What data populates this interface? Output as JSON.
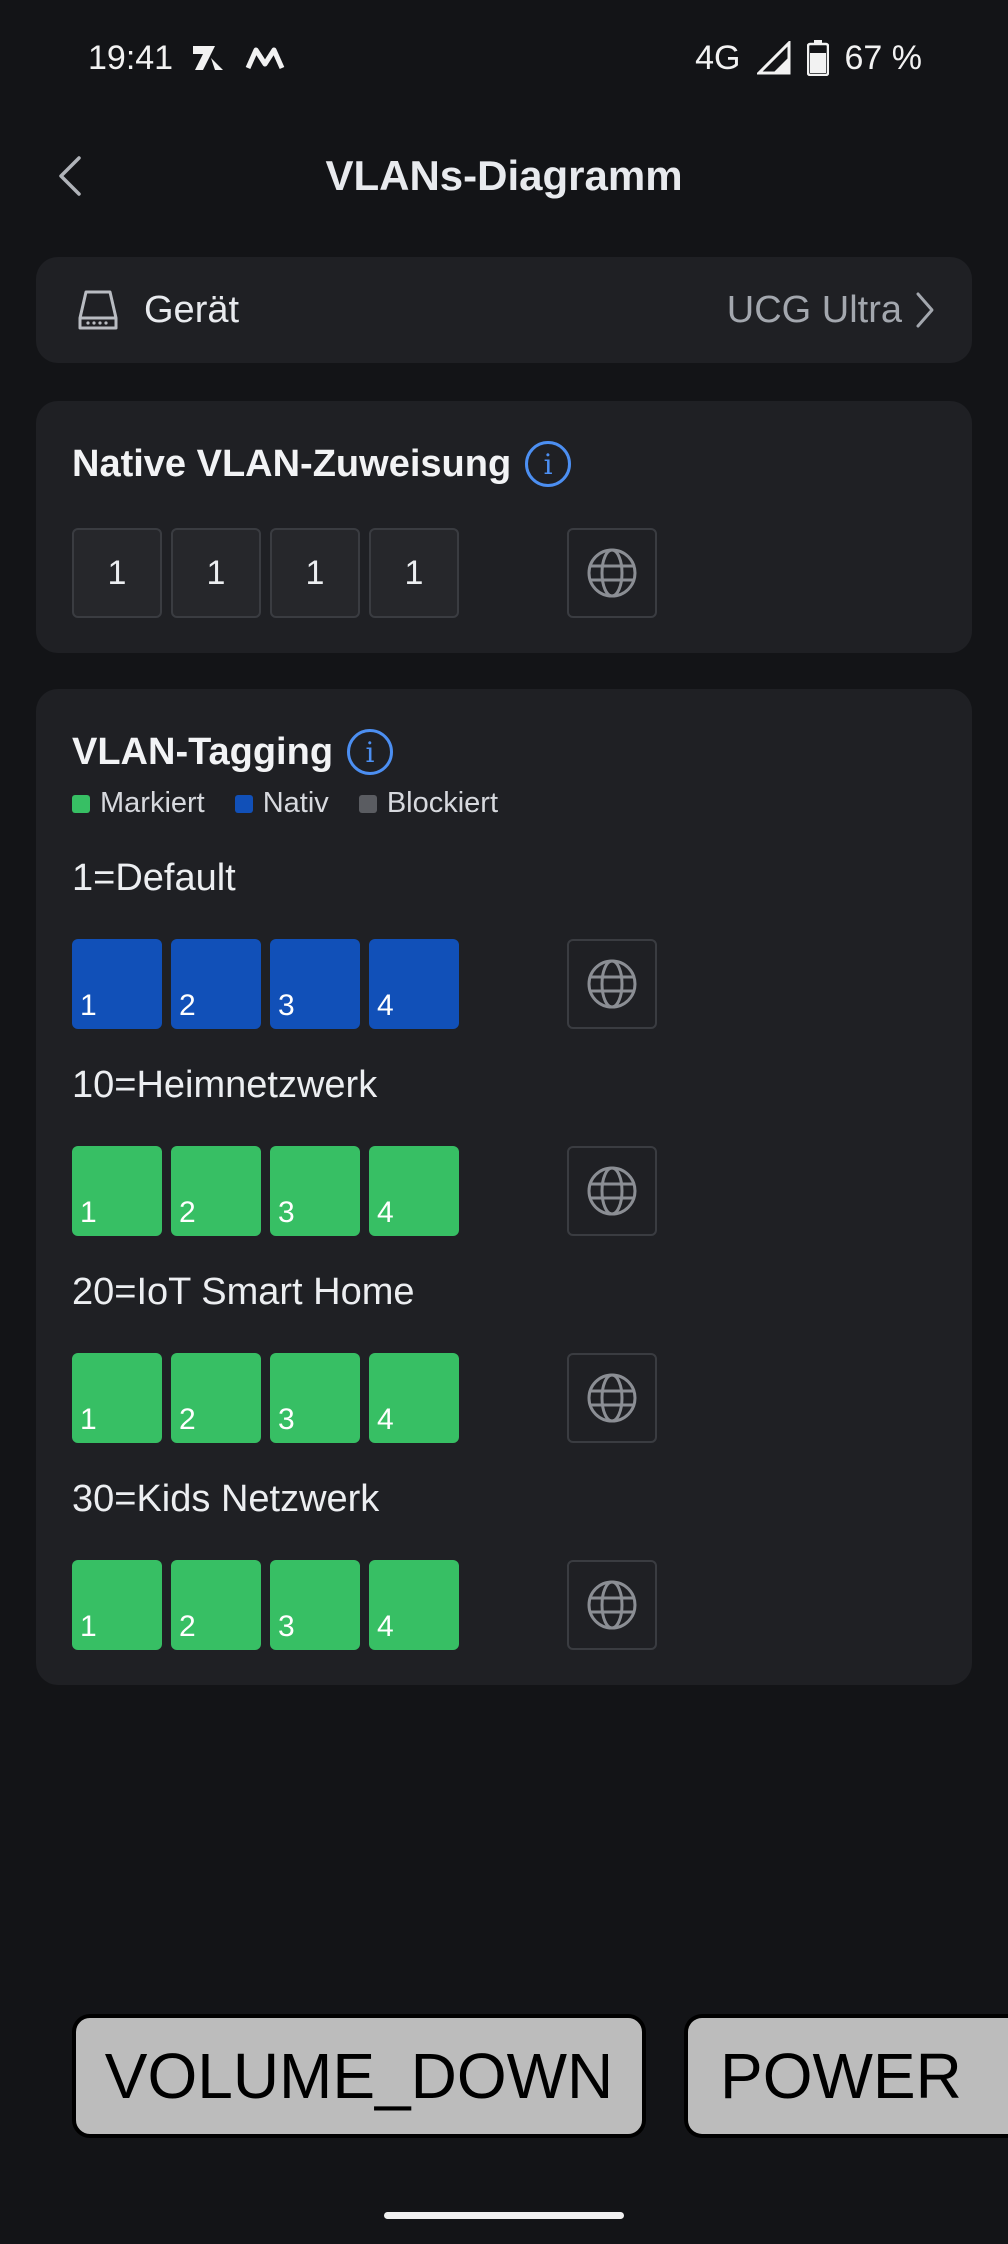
{
  "status_bar": {
    "time": "19:41",
    "network": "4G",
    "battery": "67 %"
  },
  "header": {
    "title": "VLANs-Diagramm"
  },
  "device": {
    "label": "Gerät",
    "value": "UCG Ultra"
  },
  "native": {
    "title": "Native VLAN-Zuweisung",
    "ports": [
      "1",
      "1",
      "1",
      "1"
    ]
  },
  "tagging": {
    "title": "VLAN-Tagging",
    "legend": [
      {
        "label": "Markiert",
        "color": "#37bf64"
      },
      {
        "label": "Nativ",
        "color": "#1150b8"
      },
      {
        "label": "Blockiert",
        "color": "#5a5c61"
      }
    ],
    "vlans": [
      {
        "name": "1=Default",
        "state": "native",
        "ports": [
          "1",
          "2",
          "3",
          "4"
        ]
      },
      {
        "name": "10=Heimnetzwerk",
        "state": "tagged",
        "ports": [
          "1",
          "2",
          "3",
          "4"
        ]
      },
      {
        "name": "20=IoT Smart Home",
        "state": "tagged",
        "ports": [
          "1",
          "2",
          "3",
          "4"
        ]
      },
      {
        "name": "30=Kids Netzwerk",
        "state": "tagged",
        "ports": [
          "1",
          "2",
          "3",
          "4"
        ]
      }
    ]
  },
  "keys": {
    "volume_down": "VOLUME_DOWN",
    "power": "POWER"
  },
  "icons": {
    "back": "chevron-left-icon",
    "device": "router-icon",
    "info": "info-icon",
    "wan": "globe-icon"
  }
}
